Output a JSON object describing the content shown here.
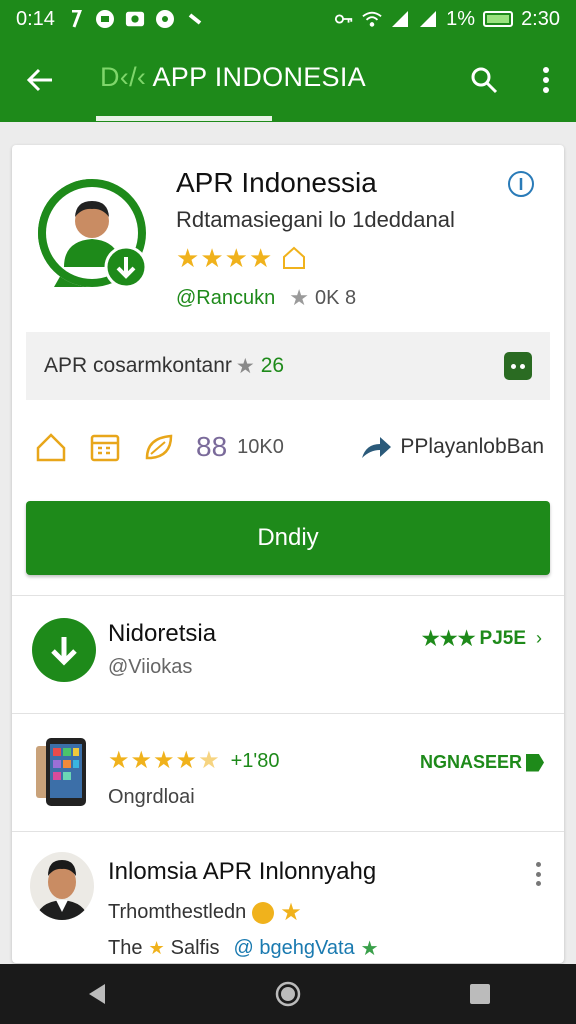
{
  "status_bar": {
    "time_left": "0:14",
    "battery_pct": "1%",
    "time_right": "2:30"
  },
  "app_bar": {
    "title_prefix": "D‹/‹",
    "title": "APP INDONESIA"
  },
  "app": {
    "name": "APR Indonessia",
    "subtitle": "Rdtamasiegani lo 1deddanal",
    "rating_stars": 4,
    "developer": "@Rancukn",
    "download_count": "0K 8"
  },
  "promo": {
    "text": "APR cosarmkontanr",
    "rating": "26"
  },
  "meta": {
    "count": "88",
    "size": "10K0",
    "share_label": "PPlayanlobBan"
  },
  "install_button": {
    "label": "Dndiy"
  },
  "list": [
    {
      "title": "Nidoretsia",
      "subtitle": "@Viiokas",
      "right_label": "PJ5E"
    },
    {
      "rating_stars": 4.5,
      "count": "+1'80",
      "subtitle": "Ongrdloai",
      "badge": "NGNASEER"
    },
    {
      "title": "Inlomsia APR Inlonnyahg",
      "subtitle": "Trhomthestledn",
      "footer_left": "The",
      "footer_mid": "Salfis",
      "footer_link": "@ bgehgVata"
    }
  ],
  "colors": {
    "primary": "#1e8a1a",
    "star": "#f0b21c",
    "nav_bar": "#1a1a1a"
  }
}
